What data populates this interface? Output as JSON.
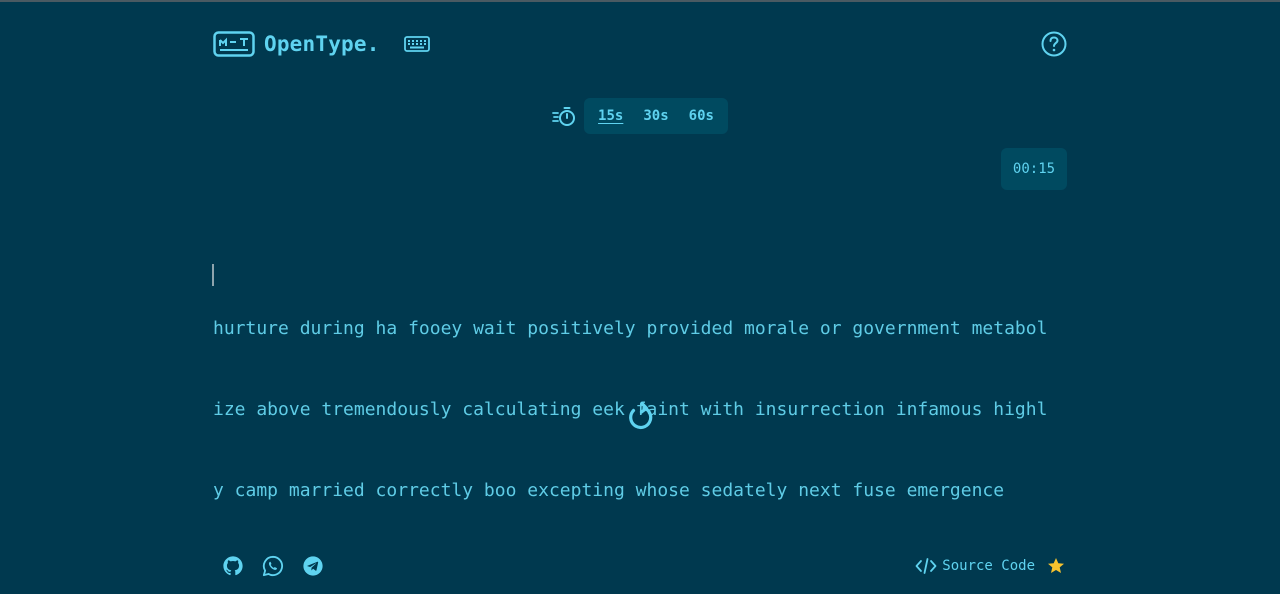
{
  "brand": {
    "name": "OpenType.",
    "logo_icon": "keyboard-logo-icon"
  },
  "header": {
    "keyboard_icon": "keyboard-icon",
    "help_icon": "help-icon"
  },
  "timer": {
    "icon": "stopwatch-icon",
    "options": [
      "15s",
      "30s",
      "60s"
    ],
    "selected": "15s",
    "countdown": "00:15"
  },
  "typing": {
    "lines": [
      "hurture during ha fooey wait positively provided morale or government metabol",
      "ize above tremendously calculating eek faint with insurrection infamous highl",
      "y camp married correctly boo excepting whose sedately next fuse emergence"
    ]
  },
  "controls": {
    "restart_icon": "restart-icon"
  },
  "footer": {
    "socials": [
      "github-icon",
      "whatsapp-icon",
      "telegram-icon"
    ],
    "source_label": "Source Code",
    "source_icon": "code-icon",
    "star_icon": "star-icon"
  },
  "colors": {
    "background": "#00394f",
    "accent": "#5fd3f0",
    "panel": "#004a60",
    "star": "#f7c32e"
  }
}
